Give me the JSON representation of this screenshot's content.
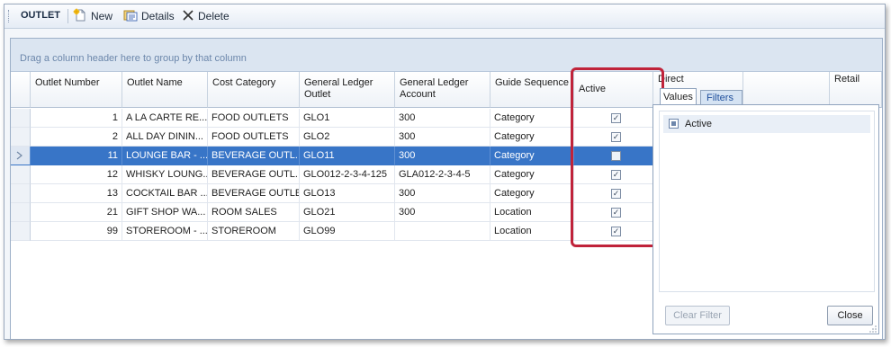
{
  "toolbar": {
    "title": "OUTLET",
    "new_label": "New",
    "details_label": "Details",
    "delete_label": "Delete"
  },
  "group_panel_text": "Drag a column header here to group by that column",
  "columns": {
    "outlet_number": "Outlet Number",
    "outlet_name": "Outlet Name",
    "cost_category": "Cost Category",
    "gl_outlet": "General Ledger Outlet",
    "gl_account": "General Ledger Account",
    "guide_sequence": "Guide Sequence",
    "active": "Active",
    "direct": "Direct",
    "retail": "Retail"
  },
  "rows": [
    {
      "outlet_number": "1",
      "outlet_name": "A LA CARTE RE...",
      "cost_category": "FOOD OUTLETS",
      "gl_outlet": "GLO1",
      "gl_account": "300",
      "guide_sequence": "Category",
      "active": true,
      "selected": false
    },
    {
      "outlet_number": "2",
      "outlet_name": "ALL DAY DININ...",
      "cost_category": "FOOD OUTLETS",
      "gl_outlet": "GLO2",
      "gl_account": "300",
      "guide_sequence": "Category",
      "active": true,
      "selected": false
    },
    {
      "outlet_number": "11",
      "outlet_name": "LOUNGE BAR - ...",
      "cost_category": "BEVERAGE OUTL...",
      "gl_outlet": "GLO11",
      "gl_account": "300",
      "guide_sequence": "Category",
      "active": false,
      "selected": true
    },
    {
      "outlet_number": "12",
      "outlet_name": "WHISKY LOUNG...",
      "cost_category": "BEVERAGE OUTL...",
      "gl_outlet": "GLO012-2-3-4-125",
      "gl_account": "GLA012-2-3-4-5",
      "guide_sequence": "Category",
      "active": true,
      "selected": false
    },
    {
      "outlet_number": "13",
      "outlet_name": "COCKTAIL BAR ...",
      "cost_category": "BEVERAGE OUTLET",
      "gl_outlet": "GLO13",
      "gl_account": "300",
      "guide_sequence": "Category",
      "active": true,
      "selected": false
    },
    {
      "outlet_number": "21",
      "outlet_name": "GIFT SHOP WA...",
      "cost_category": "ROOM SALES",
      "gl_outlet": "GLO21",
      "gl_account": "300",
      "guide_sequence": "Location",
      "active": true,
      "selected": false
    },
    {
      "outlet_number": "99",
      "outlet_name": "STOREROOM - ...",
      "cost_category": "STOREROOM",
      "gl_outlet": "GLO99",
      "gl_account": "",
      "guide_sequence": "Location",
      "active": true,
      "selected": false
    }
  ],
  "filter_popup": {
    "tab_values": "Values",
    "tab_filters": "Filters",
    "value_item": "Active",
    "clear_filter_label": "Clear Filter",
    "close_label": "Close"
  },
  "colors": {
    "selection": "#3875c7",
    "highlight_border": "#c0233a",
    "group_panel": "#dbe5f1"
  }
}
